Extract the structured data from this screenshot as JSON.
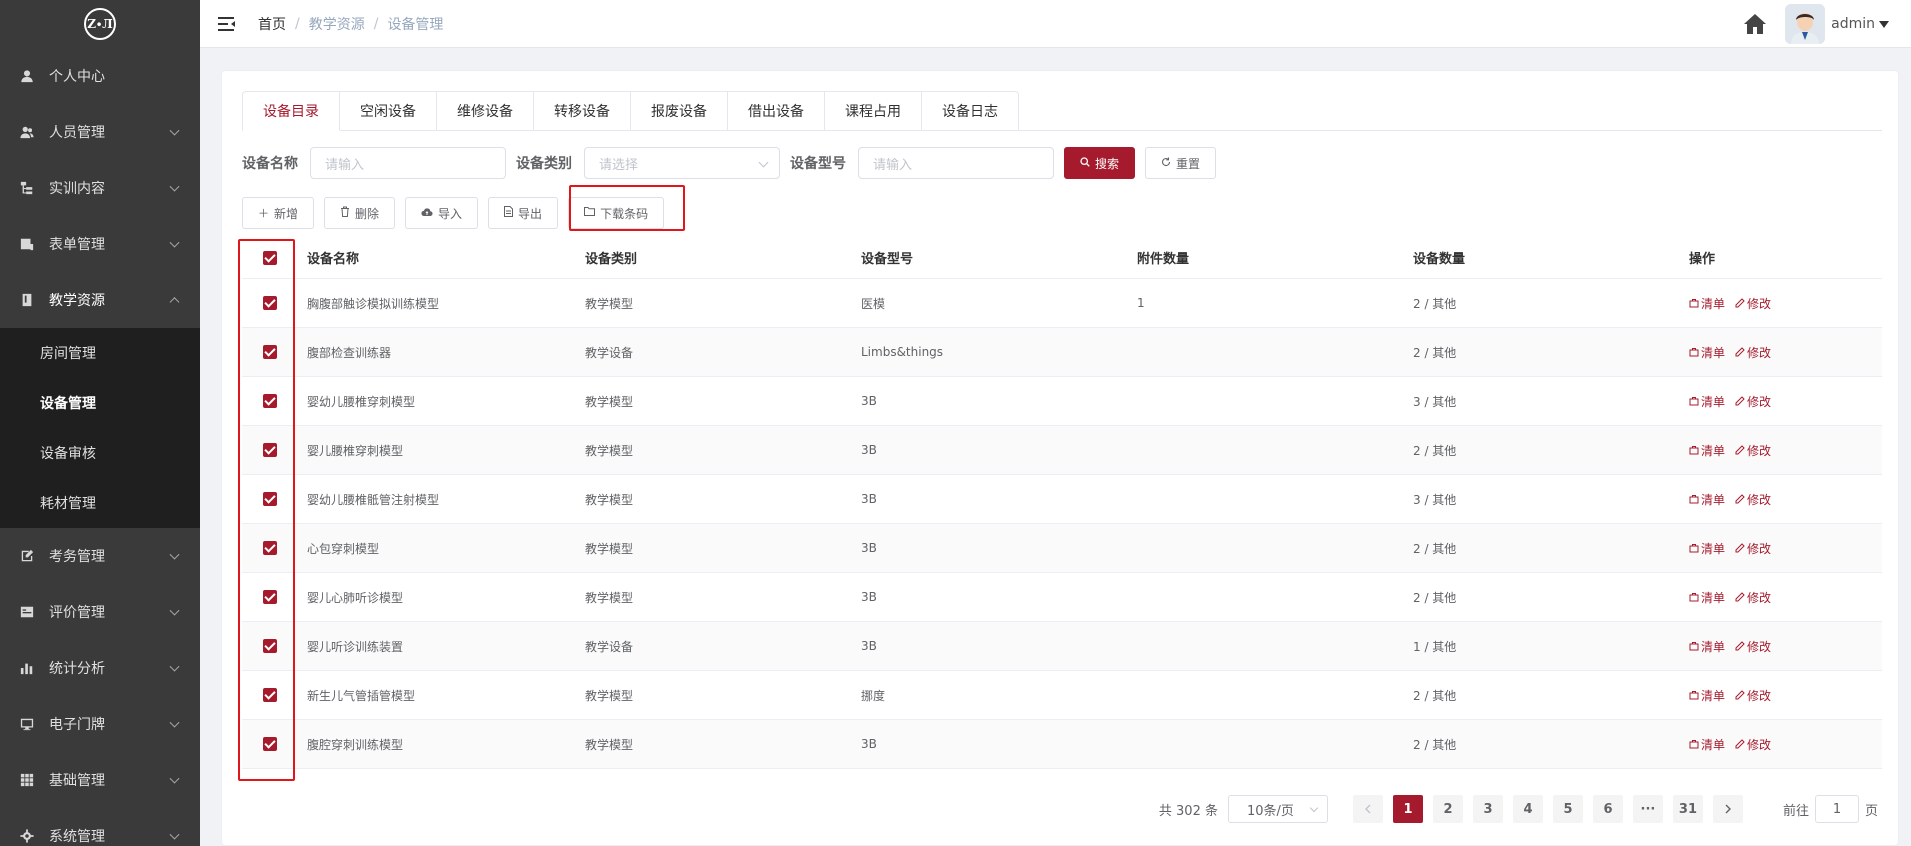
{
  "sidebar": {
    "logo_text": "Z∙Л",
    "items": [
      {
        "label": "个人中心",
        "icon": "user-icon"
      },
      {
        "label": "人员管理",
        "icon": "users-icon"
      },
      {
        "label": "实训内容",
        "icon": "tree-icon"
      },
      {
        "label": "表单管理",
        "icon": "form-icon"
      },
      {
        "label": "教学资源",
        "icon": "book-icon"
      },
      {
        "label": "考务管理",
        "icon": "edit-icon"
      },
      {
        "label": "评价管理",
        "icon": "rating-icon"
      },
      {
        "label": "统计分析",
        "icon": "chart-icon"
      },
      {
        "label": "电子门牌",
        "icon": "monitor-icon"
      },
      {
        "label": "基础管理",
        "icon": "grid-icon"
      },
      {
        "label": "系统管理",
        "icon": "gear-icon"
      }
    ],
    "submenu": [
      "房间管理",
      "设备管理",
      "设备审核",
      "耗材管理"
    ]
  },
  "header": {
    "breadcrumb": [
      "首页",
      "教学资源",
      "设备管理"
    ],
    "username": "admin"
  },
  "tabs": [
    "设备目录",
    "空闲设备",
    "维修设备",
    "转移设备",
    "报废设备",
    "借出设备",
    "课程占用",
    "设备日志"
  ],
  "filter": {
    "name_label": "设备名称",
    "name_placeholder": "请输入",
    "type_label": "设备类别",
    "type_placeholder": "请选择",
    "model_label": "设备型号",
    "model_placeholder": "请输入",
    "search": "搜索",
    "reset": "重置"
  },
  "toolbar": {
    "add": "新增",
    "delete": "删除",
    "import": "导入",
    "export": "导出",
    "download_barcode": "下载条码"
  },
  "table": {
    "columns": [
      "设备名称",
      "设备类别",
      "设备型号",
      "附件数量",
      "设备数量",
      "操作"
    ],
    "op_list": "清单",
    "op_edit": "修改",
    "rows": [
      {
        "name": "胸腹部触诊模拟训练模型",
        "type": "教学模型",
        "model": "医模",
        "attach": "1",
        "qty": "2 / 其他"
      },
      {
        "name": "腹部检查训练器",
        "type": "教学设备",
        "model": "Limbs&things",
        "attach": "",
        "qty": "2 / 其他"
      },
      {
        "name": "婴幼儿腰椎穿刺模型",
        "type": "教学模型",
        "model": "3B",
        "attach": "",
        "qty": "3 / 其他"
      },
      {
        "name": "婴儿腰椎穿刺模型",
        "type": "教学模型",
        "model": "3B",
        "attach": "",
        "qty": "2 / 其他"
      },
      {
        "name": "婴幼儿腰椎骶管注射模型",
        "type": "教学模型",
        "model": "3B",
        "attach": "",
        "qty": "3 / 其他"
      },
      {
        "name": "心包穿刺模型",
        "type": "教学模型",
        "model": "3B",
        "attach": "",
        "qty": "2 / 其他"
      },
      {
        "name": "婴儿心肺听诊模型",
        "type": "教学模型",
        "model": "3B",
        "attach": "",
        "qty": "2 / 其他"
      },
      {
        "name": "婴儿听诊训练装置",
        "type": "教学设备",
        "model": "3B",
        "attach": "",
        "qty": "1 / 其他"
      },
      {
        "name": "新生儿气管插管模型",
        "type": "教学模型",
        "model": "挪度",
        "attach": "",
        "qty": "2 / 其他"
      },
      {
        "name": "腹腔穿刺训练模型",
        "type": "教学模型",
        "model": "3B",
        "attach": "",
        "qty": "2 / 其他"
      }
    ]
  },
  "pagination": {
    "total": "共 302 条",
    "page_size": "10条/页",
    "pages": [
      "1",
      "2",
      "3",
      "4",
      "5",
      "6",
      "···",
      "31"
    ],
    "goto_prefix": "前往",
    "goto_value": "1",
    "goto_suffix": "页"
  },
  "colors": {
    "accent": "#a51b2d",
    "highlight": "#e0161a",
    "sidebar_bg": "#3a3a3a",
    "submenu_bg": "#1f1f1f"
  }
}
